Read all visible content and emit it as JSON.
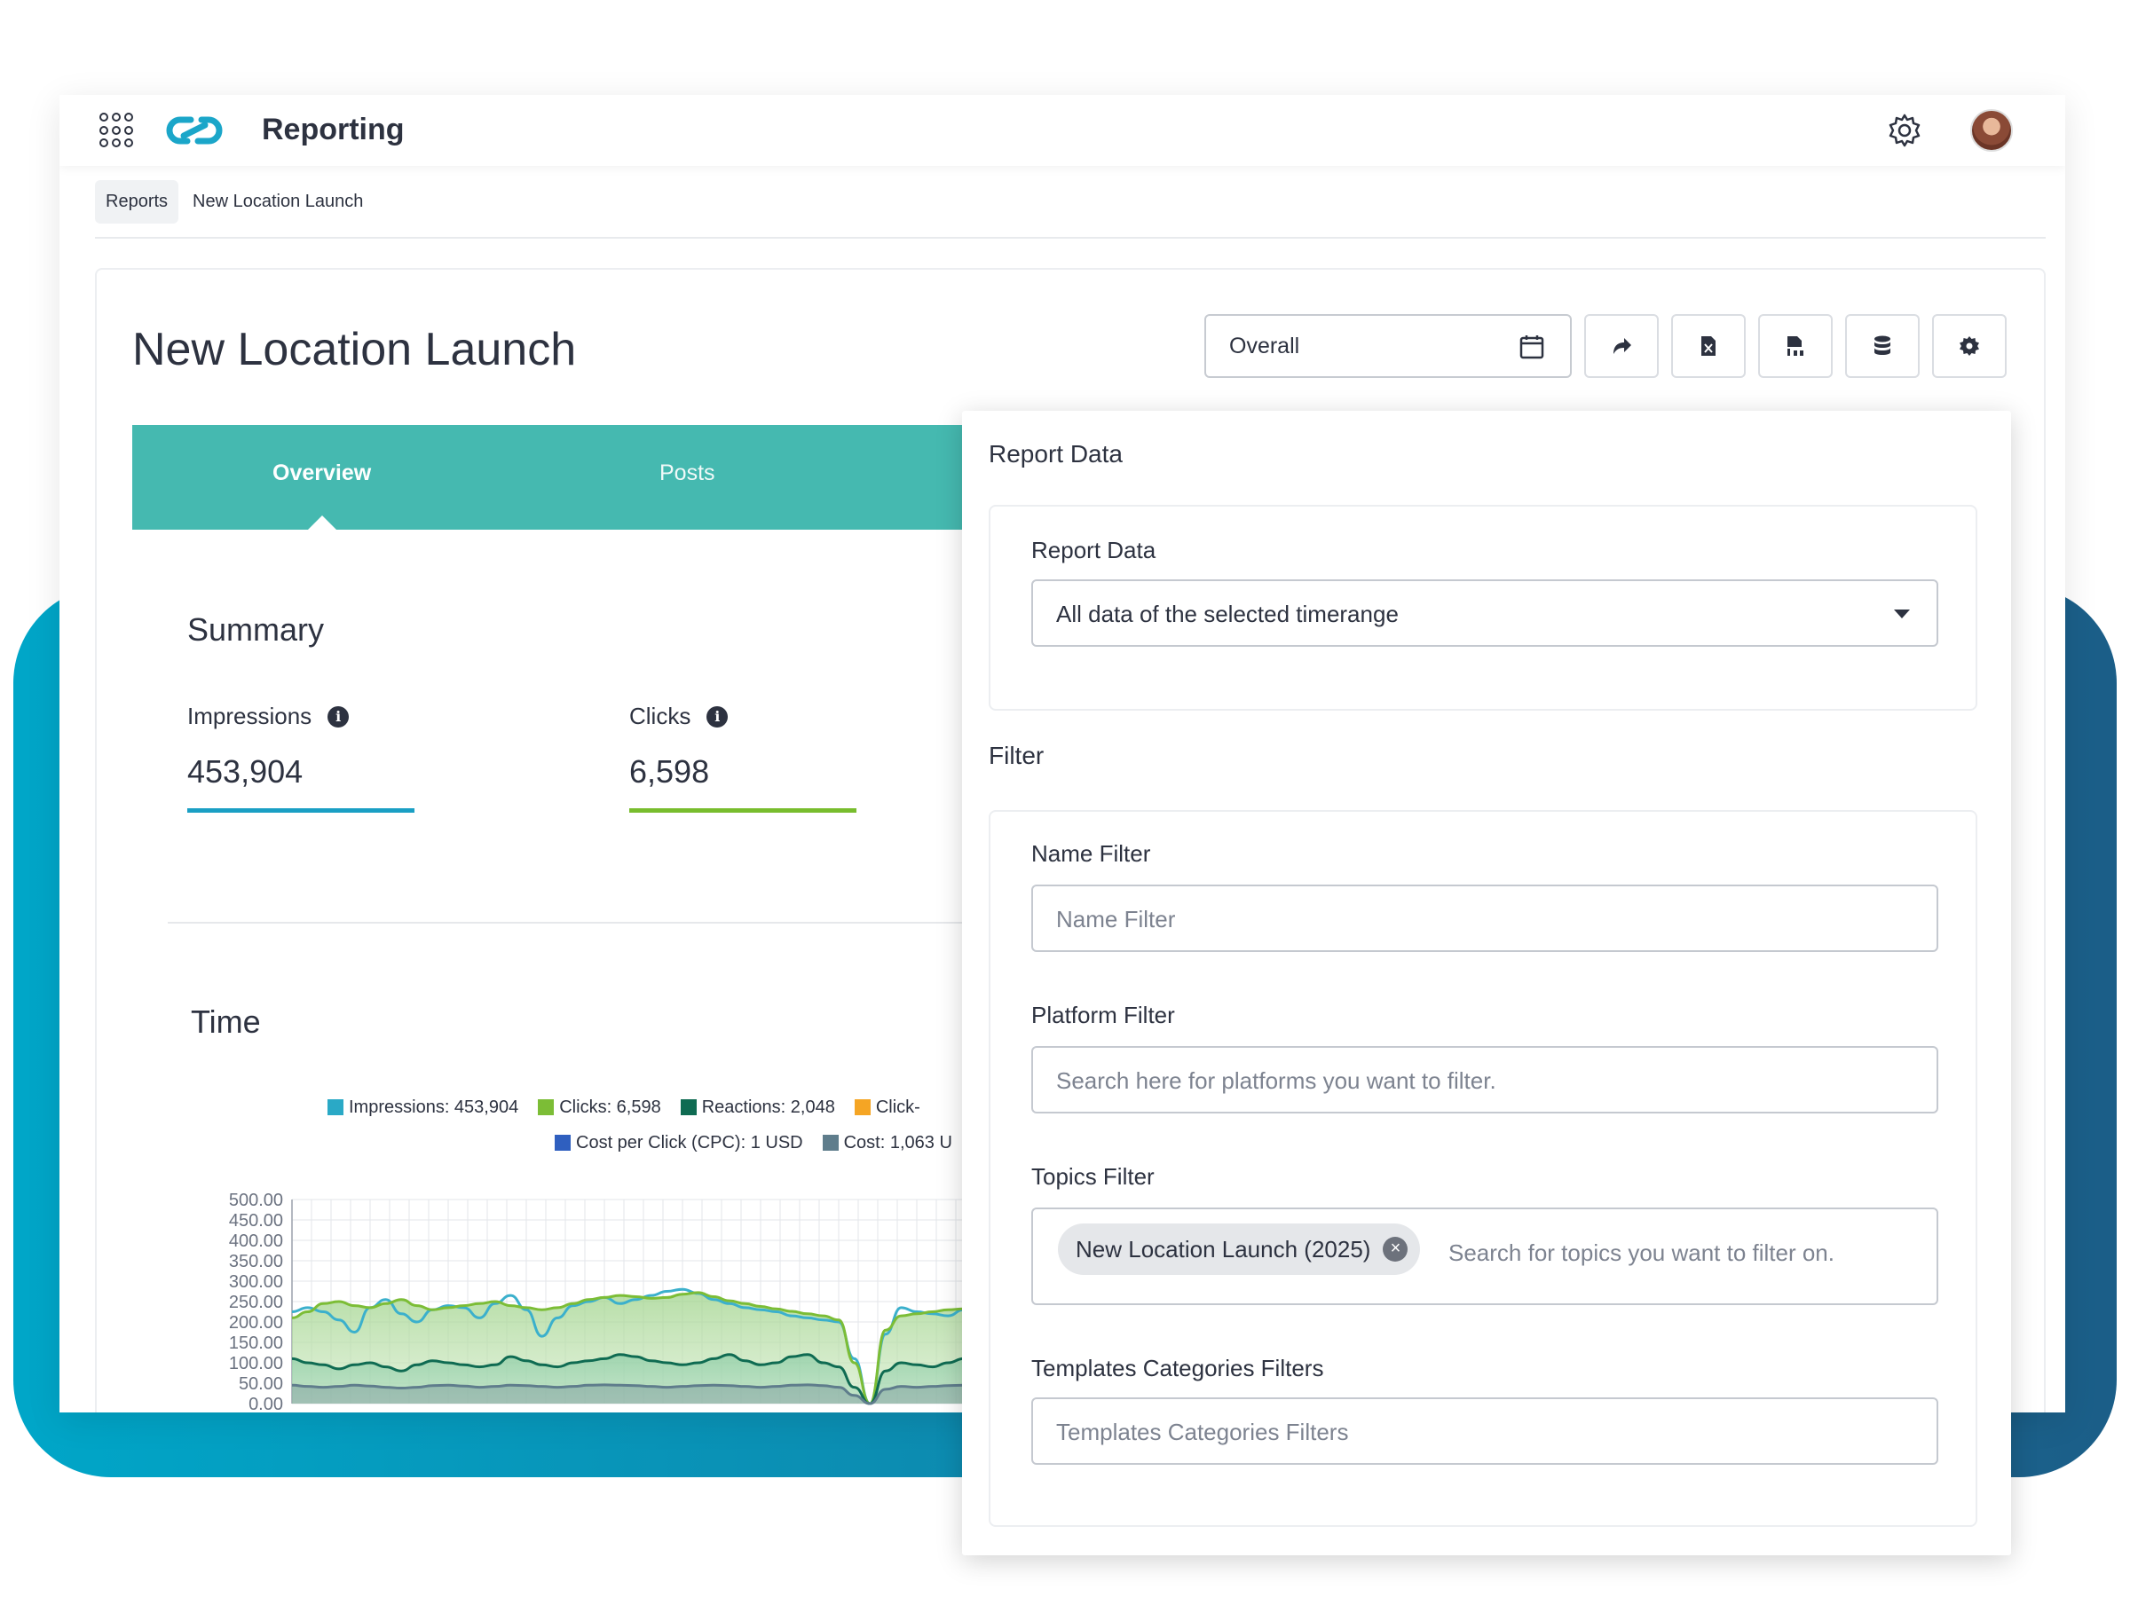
{
  "header": {
    "app_title": "Reporting",
    "icons": [
      "apps-grid-icon",
      "link-logo-icon",
      "gear-icon",
      "user-avatar"
    ]
  },
  "breadcrumb": {
    "root": "Reports",
    "current": "New Location Launch"
  },
  "report": {
    "title": "New Location Launch",
    "period_value": "Overall",
    "toolbar_icons": [
      "calendar-icon",
      "share-icon",
      "excel-export-icon",
      "pdf-export-icon",
      "database-icon",
      "settings-icon"
    ]
  },
  "tabs": [
    {
      "label": "Overview",
      "active": true
    },
    {
      "label": "Posts",
      "active": false
    }
  ],
  "summary": {
    "title": "Summary",
    "kpis": [
      {
        "label": "Impressions",
        "value": "453,904",
        "color": "#1a9fc4"
      },
      {
        "label": "Clicks",
        "value": "6,598",
        "color": "#78bd2d"
      }
    ]
  },
  "time_section": {
    "title": "Time"
  },
  "chart_data": {
    "type": "area",
    "legend": [
      {
        "text": "Impressions: 453,904",
        "color": "#2aa9c6"
      },
      {
        "text": "Clicks: 6,598",
        "color": "#7cbd36"
      },
      {
        "text": "Reactions: 2,048",
        "color": "#0f6b52"
      },
      {
        "text": "Click-",
        "color": "#f5a524"
      },
      {
        "text": "Cost per Click (CPC): 1 USD",
        "color": "#2f5fbf"
      },
      {
        "text": "Cost: 1,063 U",
        "color": "#5f7d8c"
      }
    ],
    "y_ticks": [
      "500.00",
      "450.00",
      "400.00",
      "350.00",
      "300.00",
      "250.00",
      "200.00",
      "150.00",
      "100.00",
      "50.00",
      "0.00"
    ],
    "ylim": [
      0,
      500
    ],
    "grid": true,
    "series": [
      {
        "values": [
          225,
          235,
          225,
          205,
          175,
          235,
          255,
          220,
          200,
          230,
          240,
          235,
          210,
          245,
          265,
          230,
          165,
          210,
          240,
          250,
          260,
          245,
          255,
          265,
          275,
          280,
          270,
          255,
          245,
          235,
          230,
          225,
          215,
          210,
          205,
          200,
          110,
          0,
          170,
          235,
          225,
          220,
          215,
          230,
          240,
          250,
          235,
          220,
          245,
          275,
          230
        ]
      },
      {
        "values": [
          210,
          225,
          245,
          250,
          240,
          235,
          245,
          255,
          240,
          230,
          235,
          240,
          245,
          250,
          240,
          235,
          230,
          235,
          245,
          255,
          260,
          265,
          262,
          258,
          260,
          268,
          272,
          262,
          252,
          245,
          238,
          232,
          226,
          220,
          215,
          205,
          100,
          0,
          180,
          215,
          220,
          225,
          230,
          232,
          236,
          240,
          236,
          232,
          238,
          250,
          242
        ]
      },
      {
        "values": [
          110,
          100,
          95,
          85,
          95,
          100,
          90,
          80,
          95,
          105,
          100,
          95,
          90,
          95,
          115,
          105,
          95,
          90,
          100,
          105,
          110,
          120,
          115,
          105,
          100,
          95,
          100,
          110,
          120,
          105,
          95,
          100,
          115,
          120,
          100,
          90,
          40,
          0,
          80,
          100,
          95,
          90,
          100,
          110,
          105,
          100,
          95,
          100,
          110,
          120,
          105
        ]
      },
      {
        "values": [
          45,
          42,
          40,
          42,
          45,
          43,
          40,
          38,
          40,
          44,
          45,
          43,
          40,
          42,
          45,
          44,
          42,
          40,
          42,
          45,
          46,
          45,
          44,
          42,
          40,
          42,
          44,
          45,
          44,
          42,
          40,
          42,
          45,
          46,
          44,
          40,
          20,
          0,
          35,
          42,
          40,
          42,
          44,
          45,
          44,
          42,
          40,
          42,
          44,
          46,
          44
        ]
      }
    ]
  },
  "panel": {
    "report_data_heading": "Report Data",
    "report_data_label": "Report Data",
    "report_data_value": "All data of the selected timerange",
    "filter_heading": "Filter",
    "name_filter_label": "Name Filter",
    "name_filter_placeholder": "Name Filter",
    "platform_filter_label": "Platform Filter",
    "platform_filter_placeholder": "Search here for platforms you want to filter.",
    "topics_filter_label": "Topics Filter",
    "topics_chip": "New Location Launch (2025)",
    "topics_placeholder": "Search for topics you want to filter on.",
    "templates_label": "Templates Categories Filters",
    "templates_placeholder": "Templates Categories Filters"
  }
}
